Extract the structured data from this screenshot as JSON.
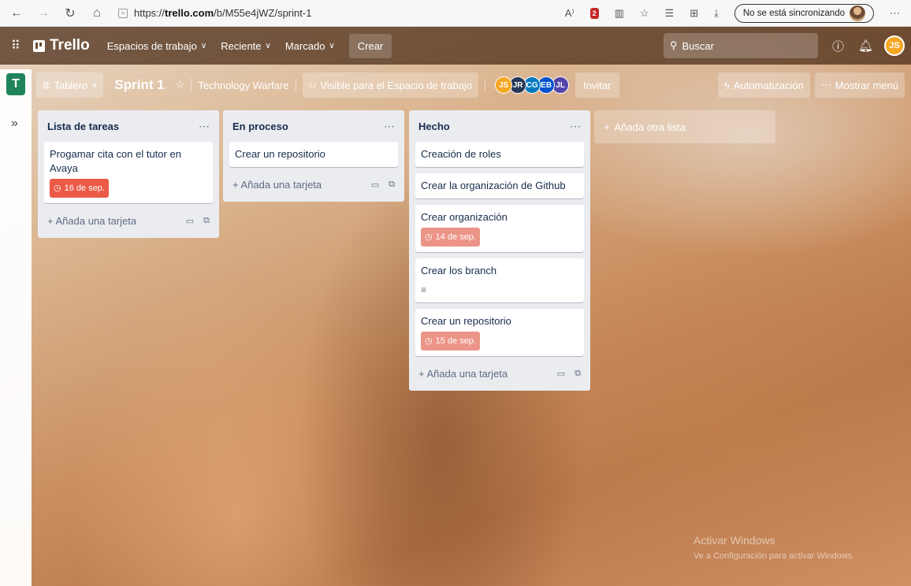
{
  "browser": {
    "url_prefix": "https://",
    "url_domain": "trello.com",
    "url_path": "/b/M55e4jWZ/sprint-1",
    "sync_label": "No se está sincronizando",
    "ext_badge": "2"
  },
  "header": {
    "logo": "Trello",
    "menus": [
      {
        "label": "Espacios de trabajo"
      },
      {
        "label": "Reciente"
      },
      {
        "label": "Marcado"
      }
    ],
    "create_label": "Crear",
    "search_placeholder": "Buscar",
    "user_initials": "JS"
  },
  "board": {
    "workspace_letter": "T",
    "view_label": "Tablero",
    "title": "Sprint 1",
    "workspace_name": "Technology Warfare",
    "visibility_label": "Visible para el Espacio de trabajo",
    "members": [
      {
        "initials": "JS",
        "color": "#f5a623"
      },
      {
        "initials": "JR",
        "color": "#253858"
      },
      {
        "initials": "CG",
        "color": "#0079bf"
      },
      {
        "initials": "EB",
        "color": "#0052cc"
      },
      {
        "initials": "JL",
        "color": "#5243aa"
      }
    ],
    "invite_label": "Invitar",
    "automation_label": "Automatización",
    "menu_label": "Mostrar menú",
    "add_list_label": "Añada otra lista"
  },
  "lists": [
    {
      "title": "Lista de tareas",
      "cards": [
        {
          "title": "Progamar cita con el tutor en Avaya",
          "due": "16 de sep."
        }
      ],
      "add_card_label": "Añada una tarjeta"
    },
    {
      "title": "En proceso",
      "cards": [
        {
          "title": "Crear un repositorio"
        }
      ],
      "add_card_label": "Añada una tarjeta"
    },
    {
      "title": "Hecho",
      "cards": [
        {
          "title": "Creación de roles"
        },
        {
          "title": "Crear la organización de Github"
        },
        {
          "title": "Crear organización",
          "due": "14 de sep."
        },
        {
          "title": "Crear los branch"
        },
        {
          "title": "Crear un repositorio",
          "due": "15 de sep."
        }
      ],
      "add_card_label": "Añada una tarjeta"
    }
  ],
  "watermark": {
    "title": "Activar Windows",
    "subtitle": "Ve a Configuración para activar Windows."
  },
  "icons": {
    "back": "back-arrow-icon",
    "clock": "clock-icon",
    "description": "description-icon"
  }
}
